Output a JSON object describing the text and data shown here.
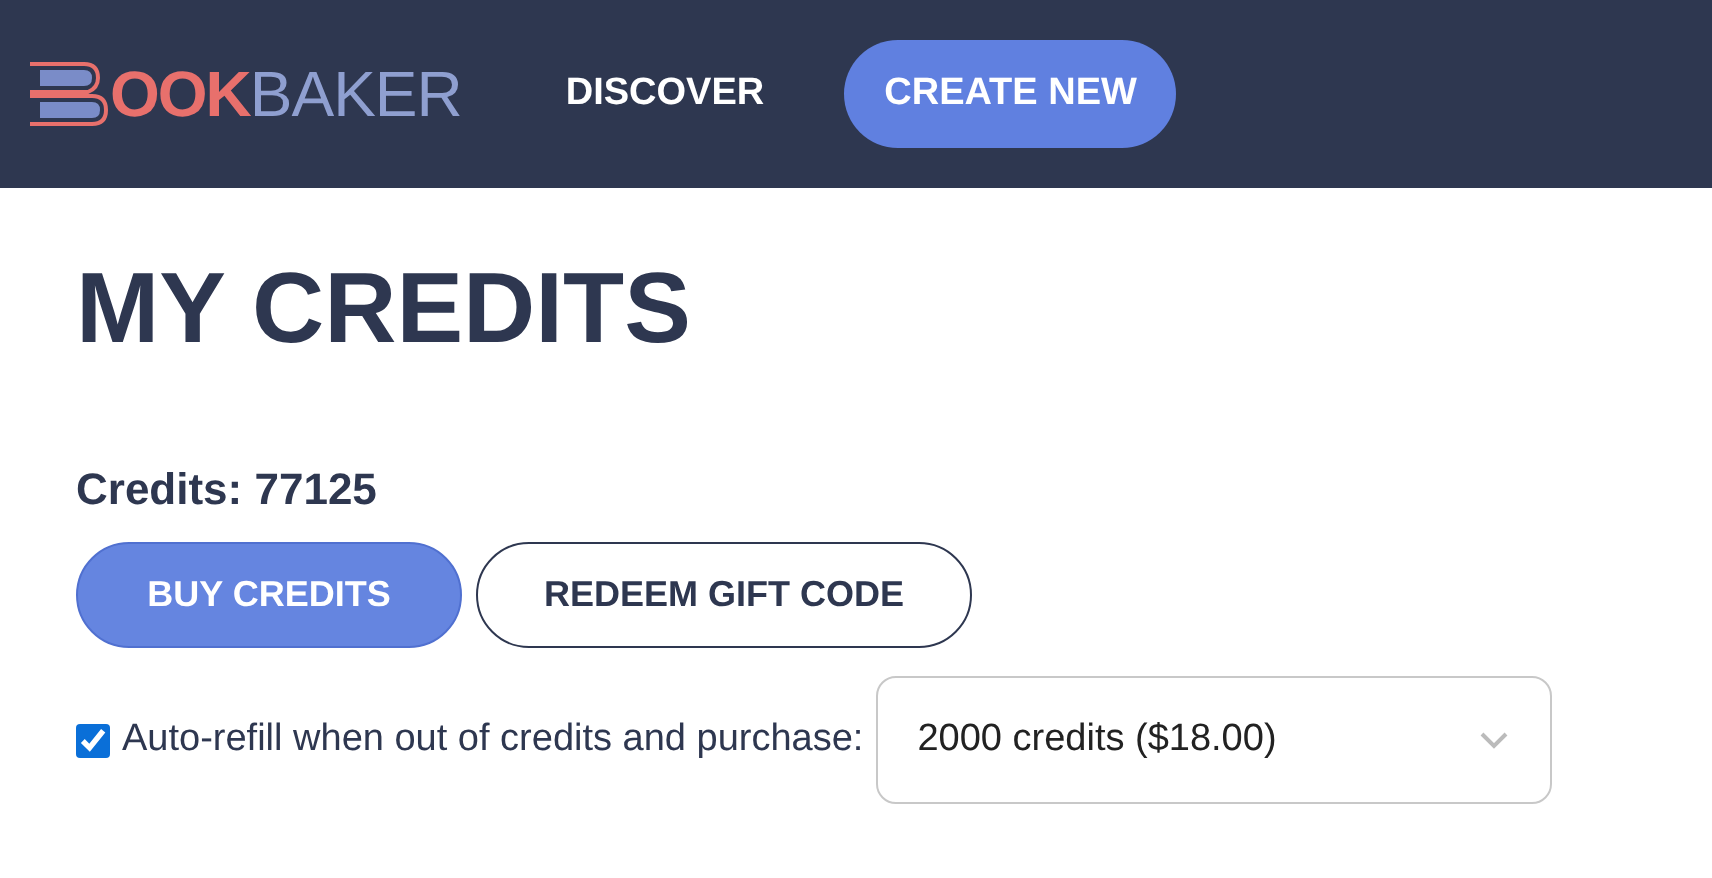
{
  "header": {
    "logo": {
      "first": "OOK",
      "second": "BAKER"
    },
    "nav": [
      {
        "label": "DISCOVER",
        "kind": "link"
      },
      {
        "label": "CREATE NEW",
        "kind": "button"
      }
    ]
  },
  "page": {
    "title": "MY CREDITS",
    "credits": "Credits: 77125",
    "buttons": [
      {
        "label": "BUY CREDITS",
        "kind": "primary"
      },
      {
        "label": "REDEEM GIFT CODE",
        "kind": "outline"
      }
    ],
    "auto_refill": {
      "checked": true,
      "label": "Auto-refill when out of credits and purchase:",
      "value": "2000 credits ($18.00)"
    }
  }
}
